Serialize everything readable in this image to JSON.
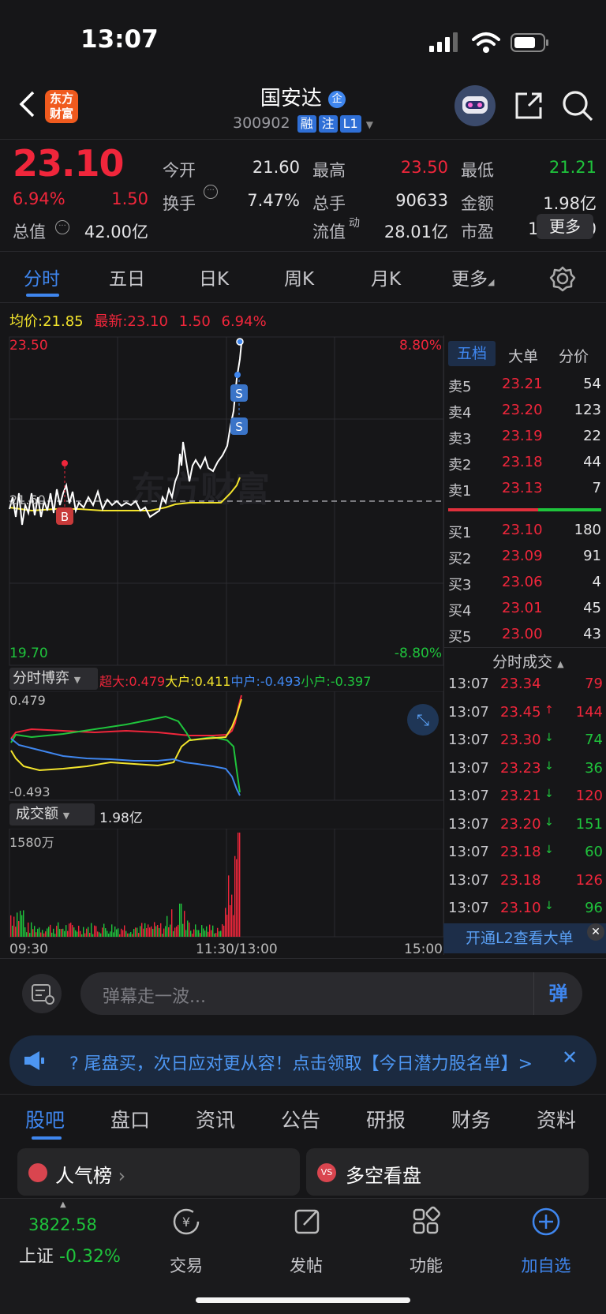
{
  "status": {
    "time": "13:07"
  },
  "header": {
    "title": "国安达",
    "code": "300902",
    "tags": [
      "融",
      "注",
      "L1"
    ],
    "logo_text_1": "东方",
    "logo_text_2": "财富"
  },
  "quote": {
    "price": "23.10",
    "pct": "6.94%",
    "chg": "1.50",
    "fields": [
      {
        "label": "今开",
        "value": "21.60",
        "color": "#e4e4e6"
      },
      {
        "label": "最高",
        "value": "23.50",
        "color": "#f0263b"
      },
      {
        "label": "最低",
        "value": "21.21",
        "color": "#1fc43c"
      },
      {
        "label": "换手",
        "value": "7.47%",
        "color": "#e4e4e6"
      },
      {
        "label": "总手",
        "value": "90633",
        "color": "#e4e4e6"
      },
      {
        "label": "金额",
        "value": "1.98亿",
        "color": "#e4e4e6"
      },
      {
        "label": "总值",
        "value": "42.00亿",
        "color": "#e4e4e6"
      },
      {
        "label": "流值",
        "value": "28.01亿",
        "color": "#e4e4e6"
      },
      {
        "label": "市盈",
        "value": "1512.50",
        "color": "#e4e4e6"
      }
    ],
    "pe_sup": "动",
    "more": "更多"
  },
  "tabs": [
    "分时",
    "五日",
    "日K",
    "周K",
    "月K",
    "更多"
  ],
  "avg": {
    "avg_label": "均价:",
    "avg_value": "21.85",
    "last_label": "最新:",
    "last_value": "23.10",
    "chg": "1.50",
    "pct": "6.94%"
  },
  "chart": {
    "y_top": "23.50",
    "y_bottom": "19.70",
    "pct_top": "8.80%",
    "pct_bottom": "-8.80%",
    "y_mid": "21.60",
    "watermark": "东方财富",
    "x_labels": [
      "09:30",
      "11:30/13:00",
      "15:00"
    ],
    "markers": [
      "B",
      "S",
      "S"
    ]
  },
  "flow": {
    "title": "分时博弈",
    "items": [
      {
        "label": "超大:",
        "value": "0.479",
        "color": "#f0263b"
      },
      {
        "label": "大户:",
        "value": "0.411",
        "color": "#f3e42c"
      },
      {
        "label": "中户:",
        "value": "-0.493",
        "color": "#3f86ee"
      },
      {
        "label": "小户:",
        "value": "-0.397",
        "color": "#1fc43c"
      }
    ],
    "y_top": "0.479",
    "y_bottom": "-0.493"
  },
  "volume": {
    "title": "成交额",
    "total": "1.98亿",
    "y_top": "1580万"
  },
  "orderbook": {
    "tabs": [
      "五档",
      "大单",
      "分价"
    ],
    "asks": [
      {
        "l": "卖5",
        "p": "23.21",
        "v": "54"
      },
      {
        "l": "卖4",
        "p": "23.20",
        "v": "123"
      },
      {
        "l": "卖3",
        "p": "23.19",
        "v": "22"
      },
      {
        "l": "卖2",
        "p": "23.18",
        "v": "44"
      },
      {
        "l": "卖1",
        "p": "23.13",
        "v": "7"
      }
    ],
    "bids": [
      {
        "l": "买1",
        "p": "23.10",
        "v": "180"
      },
      {
        "l": "买2",
        "p": "23.09",
        "v": "91"
      },
      {
        "l": "买3",
        "p": "23.06",
        "v": "4"
      },
      {
        "l": "买4",
        "p": "23.01",
        "v": "45"
      },
      {
        "l": "买5",
        "p": "23.00",
        "v": "43"
      }
    ]
  },
  "trades": {
    "title": "分时成交",
    "rows": [
      {
        "t": "13:07",
        "p": "23.34",
        "a": "",
        "v": "79",
        "c": "#f0263b"
      },
      {
        "t": "13:07",
        "p": "23.45",
        "a": "↑",
        "v": "144",
        "c": "#f0263b"
      },
      {
        "t": "13:07",
        "p": "23.30",
        "a": "↓",
        "v": "74",
        "c": "#1fc43c"
      },
      {
        "t": "13:07",
        "p": "23.23",
        "a": "↓",
        "v": "36",
        "c": "#1fc43c"
      },
      {
        "t": "13:07",
        "p": "23.21",
        "a": "↓",
        "v": "120",
        "c": "#f0263b"
      },
      {
        "t": "13:07",
        "p": "23.20",
        "a": "↓",
        "v": "151",
        "c": "#1fc43c"
      },
      {
        "t": "13:07",
        "p": "23.18",
        "a": "↓",
        "v": "60",
        "c": "#1fc43c"
      },
      {
        "t": "13:07",
        "p": "23.18",
        "a": "",
        "v": "126",
        "c": "#f0263b"
      },
      {
        "t": "13:07",
        "p": "23.10",
        "a": "↓",
        "v": "96",
        "c": "#1fc43c"
      }
    ],
    "l2": "开通L2查看大单"
  },
  "comment": {
    "placeholder": "弹幕走一波...",
    "send": "弹"
  },
  "notice": {
    "text": "?  尾盘买，次日应对更从容！点击领取【今日潜力股名单】>"
  },
  "news_tabs": [
    "股吧",
    "盘口",
    "资讯",
    "公告",
    "研报",
    "财务",
    "资料"
  ],
  "cards": [
    "人气榜",
    "多空看盘"
  ],
  "bottom": {
    "index_value": "3822.58",
    "index_name": "上证",
    "index_pct": "-0.32%",
    "items": [
      "交易",
      "发帖",
      "功能",
      "加自选"
    ]
  },
  "colors": {
    "up": "#f0263b",
    "down": "#1fc43c",
    "accent": "#3f86ee",
    "avg": "#f3e42c"
  }
}
